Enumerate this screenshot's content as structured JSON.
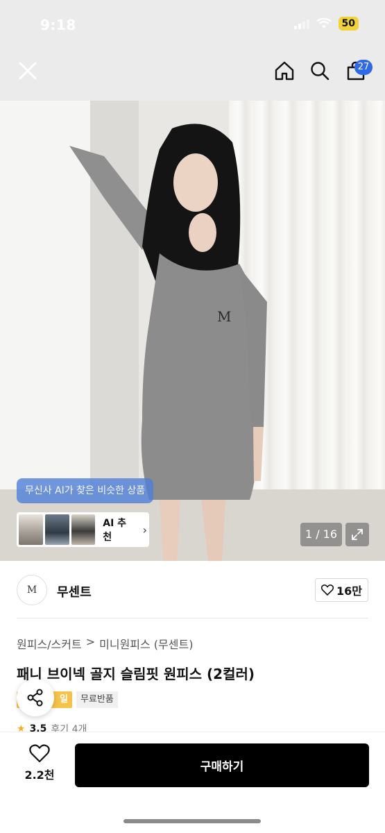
{
  "status": {
    "time": "9:18",
    "battery": "50"
  },
  "nav": {
    "cart_count": "27"
  },
  "gallery": {
    "ai_tooltip": "무신사 AI가 찾은 비슷한 상품",
    "ai_label": "AI 추천",
    "pager": "1 / 16"
  },
  "brand": {
    "logo_text": "M",
    "name": "무센트",
    "likes": "16만"
  },
  "breadcrumb": {
    "category": "원피스/스커트",
    "separator": ">",
    "subcategory": "미니원피스 (무센트)"
  },
  "product": {
    "title": "패니 브이넥 골지 슬림핏 원피스 (2컬러)",
    "tag_date": "일",
    "tag_free_return": "무료반품",
    "rating": "3.5",
    "reviews": "후기 4개"
  },
  "bottom": {
    "wish_count": "2.2천",
    "buy_label": "구매하기"
  },
  "colors": {
    "accent": "#2f6ae6",
    "buy": "#000000",
    "star": "#f2b01e"
  }
}
